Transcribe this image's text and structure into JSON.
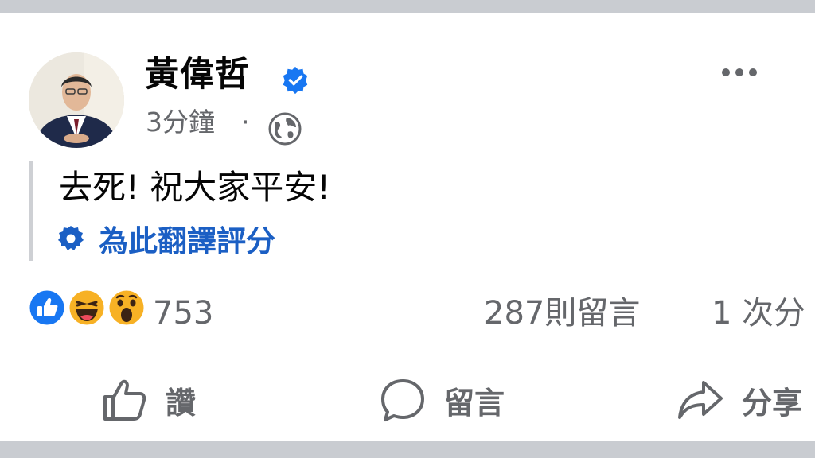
{
  "post": {
    "author": "黃偉哲",
    "verified_icon": "verified-badge-icon",
    "time": "3分鐘",
    "separator": "·",
    "audience_icon": "globe-icon",
    "text": "去死! 祝大家平安!",
    "translate_label": "為此翻譯評分",
    "more_icon": "more-options-icon"
  },
  "stats": {
    "reactions": [
      "like",
      "haha",
      "wow"
    ],
    "reaction_count": "753",
    "comments": "287則留言",
    "shares": "1 次分"
  },
  "actions": {
    "like": "讚",
    "comment": "留言",
    "share": "分享"
  },
  "colors": {
    "link_blue": "#1b5fc4",
    "like_blue": "#1877f2",
    "secondary_text": "#65676b",
    "background_gray": "#c9ccd1"
  }
}
